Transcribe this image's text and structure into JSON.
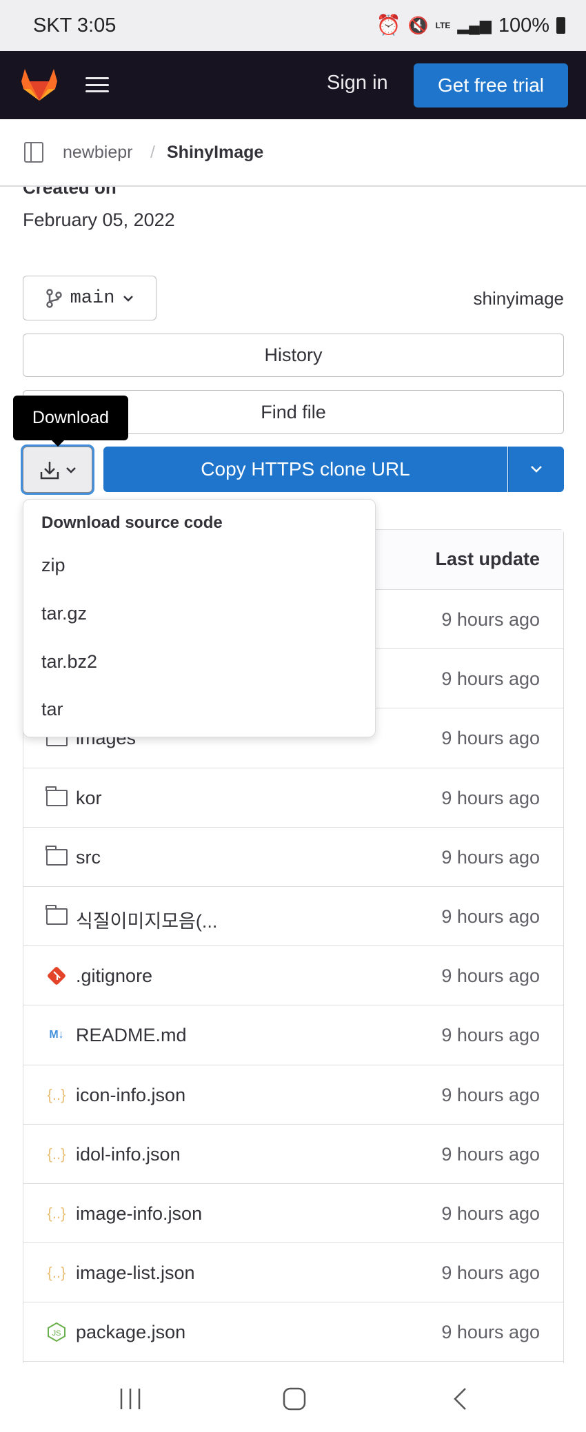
{
  "status_bar": {
    "carrier_time": "SKT 3:05",
    "network": "LTE",
    "battery": "100%",
    "icons": [
      "alarm-icon",
      "mute-icon",
      "lte-icon",
      "signal-icon",
      "battery-icon"
    ]
  },
  "topbar": {
    "sign_in": "Sign in",
    "trial": "Get free trial"
  },
  "breadcrumb": {
    "group": "newbiepr",
    "separator": "/",
    "project": "ShinyImage"
  },
  "project": {
    "created_label": "Created on",
    "created_date": "February 05, 2022",
    "name": "shinyimage"
  },
  "branch": {
    "name": "main"
  },
  "buttons": {
    "history": "History",
    "find_file": "Find file",
    "copy_clone": "Copy HTTPS clone URL"
  },
  "tooltip": "Download",
  "download_menu": {
    "header": "Download source code",
    "items": [
      "zip",
      "tar.gz",
      "tar.bz2",
      "tar"
    ]
  },
  "table": {
    "header_last_update": "Last update",
    "rows": [
      {
        "name": "",
        "type": "folder",
        "time": "9 hours ago"
      },
      {
        "name": "",
        "type": "folder",
        "time": "9 hours ago"
      },
      {
        "name": "images",
        "type": "folder",
        "time": "9 hours ago"
      },
      {
        "name": "kor",
        "type": "folder",
        "time": "9 hours ago"
      },
      {
        "name": "src",
        "type": "folder",
        "time": "9 hours ago"
      },
      {
        "name": "식질이미지모음(...",
        "type": "folder",
        "time": "9 hours ago"
      },
      {
        "name": ".gitignore",
        "type": "git",
        "time": "9 hours ago"
      },
      {
        "name": "README.md",
        "type": "markdown",
        "time": "9 hours ago"
      },
      {
        "name": "icon-info.json",
        "type": "json",
        "time": "9 hours ago"
      },
      {
        "name": "idol-info.json",
        "type": "json",
        "time": "9 hours ago"
      },
      {
        "name": "image-info.json",
        "type": "json",
        "time": "9 hours ago"
      },
      {
        "name": "image-list.json",
        "type": "json",
        "time": "9 hours ago"
      },
      {
        "name": "package.json",
        "type": "nodejs",
        "time": "9 hours ago"
      }
    ]
  },
  "colors": {
    "header_bg": "#171321",
    "primary": "#1f75cb",
    "git": "#e24329",
    "markdown": "#428fdc",
    "json": "#e9be74",
    "nodejs": "#6ab04c"
  }
}
